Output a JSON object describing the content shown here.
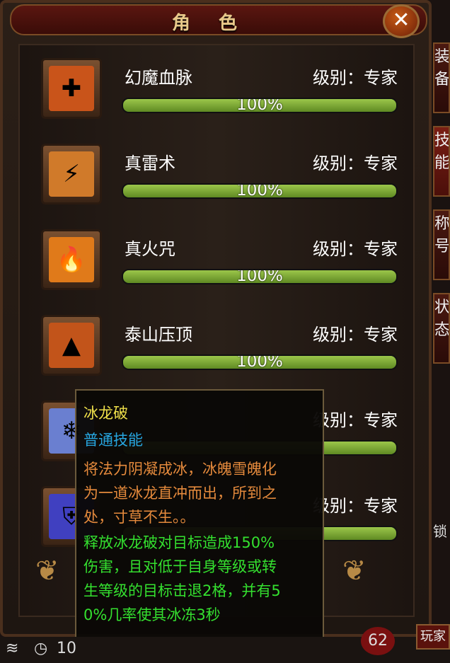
{
  "window": {
    "title": "角色",
    "close_label": "✕"
  },
  "skills": [
    {
      "name": "幻魔血脉",
      "level": "级别：专家",
      "progress": 1.0,
      "progress_text": "100%",
      "icon": "blood-vein-icon",
      "color": "#c9541a"
    },
    {
      "name": "真雷术",
      "level": "级别：专家",
      "progress": 1.0,
      "progress_text": "100%",
      "icon": "thunder-icon",
      "color": "#d07a2a"
    },
    {
      "name": "真火咒",
      "level": "级别：专家",
      "progress": 1.0,
      "progress_text": "100%",
      "icon": "fire-icon",
      "color": "#e07a1a"
    },
    {
      "name": "泰山压顶",
      "level": "级别：专家",
      "progress": 1.0,
      "progress_text": "100%",
      "icon": "mountain-icon",
      "color": "#c2541a"
    },
    {
      "name": "冰龙破",
      "level": "级别：专家",
      "progress": 1.0,
      "progress_text": "",
      "icon": "ice-dragon-icon",
      "color": "#6a7fd0"
    },
    {
      "name": "",
      "level": "级别：专家",
      "progress": 1.0,
      "progress_text": "",
      "icon": "shield-icon",
      "color": "#4040c0"
    }
  ],
  "right_tabs": [
    "装备",
    "技能",
    "称号",
    "状态"
  ],
  "tooltip": {
    "name": "冰龙破",
    "type": "普通技能",
    "desc_lines": [
      "将法力阴凝成冰，冰魄雪魄化",
      "为一道冰龙直冲而出，所到之",
      "处，寸草不生。。"
    ],
    "effect_lines": [
      "释放冰龙破对目标造成150%",
      "伤害，且对低于自身等级或转",
      "生等级的目标击退2格，并有5",
      "0%几率使其冰冻3秒"
    ]
  },
  "bottom": {
    "clock_text": "10",
    "badge": "62",
    "player_button": "玩家",
    "side_fragment": "锁"
  },
  "colors": {
    "progress_green": "#8fbf3e",
    "tooltip_name": "#f0e14a",
    "tooltip_type": "#27a6e0",
    "tooltip_desc": "#e58a3c",
    "tooltip_effect": "#34e02f"
  }
}
